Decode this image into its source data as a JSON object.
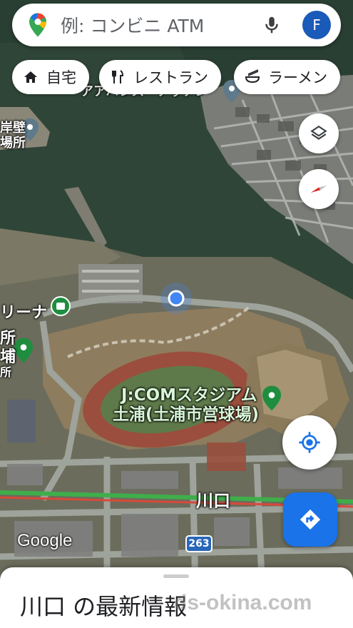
{
  "search": {
    "placeholder": "例: コンビニ ATM",
    "avatar_letter": "F"
  },
  "chips": [
    {
      "label": "自宅",
      "icon": "home-icon"
    },
    {
      "label": "レストラン",
      "icon": "restaurant-icon"
    },
    {
      "label": "ラーメン",
      "icon": "ramen-icon"
    }
  ],
  "map": {
    "labels": {
      "place_top_partial": "アアハレス・アッアン",
      "place_left_top_1": "岸壁",
      "place_left_top_2": "場所",
      "place_left_mid": "リーナ",
      "place_left_low_1": "所",
      "place_left_low_2": "埔",
      "place_left_low_3": "所",
      "stadium_line1": "J:COMスタジアム",
      "stadium_line2": "土浦(土浦市営球場)",
      "area_name": "川口"
    },
    "route_shield": "263",
    "attribution": "Google"
  },
  "bottom_sheet": {
    "title": "川口 の最新情報"
  },
  "watermark": "ds-okina.com",
  "colors": {
    "accent": "#1a73e8",
    "pin_green": "#1e8e3e",
    "pin_gray": "#5f7a8a"
  }
}
